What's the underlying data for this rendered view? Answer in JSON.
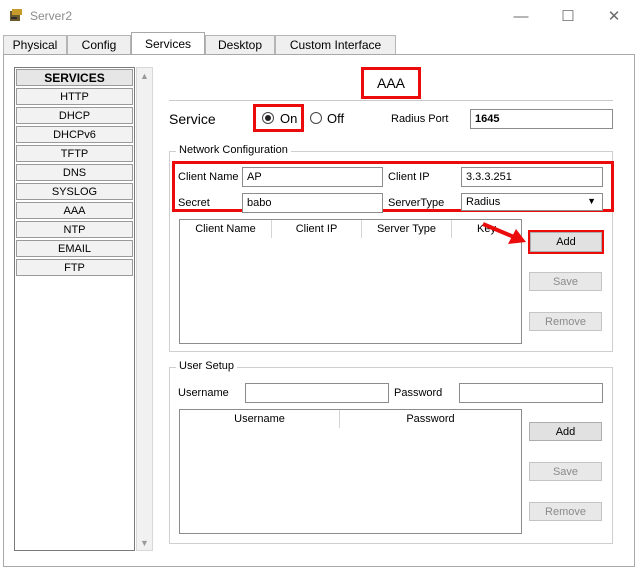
{
  "window": {
    "title": "Server2",
    "minimize_glyph": "—",
    "maximize_glyph": "☐",
    "close_glyph": "✕"
  },
  "tabs": [
    {
      "label": "Physical"
    },
    {
      "label": "Config"
    },
    {
      "label": "Services"
    },
    {
      "label": "Desktop"
    },
    {
      "label": "Custom Interface"
    }
  ],
  "services": {
    "header": "SERVICES",
    "items": [
      "HTTP",
      "DHCP",
      "DHCPv6",
      "TFTP",
      "DNS",
      "SYSLOG",
      "AAA",
      "NTP",
      "EMAIL",
      "FTP"
    ]
  },
  "aaa": {
    "title": "AAA",
    "service_label": "Service",
    "on_label": "On",
    "off_label": "Off",
    "radius_port_label": "Radius Port",
    "radius_port_value": "1645",
    "network": {
      "title": "Network Configuration",
      "client_name_label": "Client Name",
      "client_name_value": "AP",
      "client_ip_label": "Client IP",
      "client_ip_value": "3.3.3.251",
      "secret_label": "Secret",
      "secret_value": "babo",
      "server_type_label": "ServerType",
      "server_type_value": "Radius",
      "columns": [
        "Client Name",
        "Client IP",
        "Server Type",
        "Key"
      ],
      "add_label": "Add",
      "save_label": "Save",
      "remove_label": "Remove"
    },
    "user_setup": {
      "title": "User Setup",
      "username_label": "Username",
      "password_label": "Password",
      "columns": [
        "Username",
        "Password"
      ],
      "add_label": "Add",
      "save_label": "Save",
      "remove_label": "Remove"
    }
  },
  "colors": {
    "highlight": "#ec0b0b",
    "window_border": "#a8a8a8"
  }
}
